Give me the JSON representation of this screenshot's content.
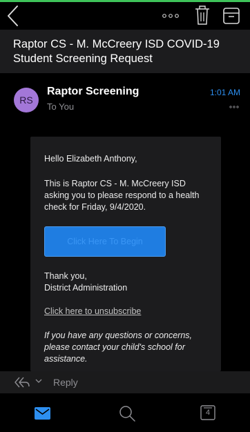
{
  "colors": {
    "accent": "#2d8ff0",
    "avatar_bg": "#a377d8",
    "button_bg": "#1f7de1",
    "status_green": "#3ec35a"
  },
  "nav": {
    "back_icon": "chevron-left-icon",
    "more_icon": "ellipsis-icon",
    "delete_icon": "trash-icon",
    "archive_icon": "archive-icon"
  },
  "message": {
    "subject": "Raptor CS - M. McCreery ISD COVID-19 Student Screening Request",
    "sender": {
      "initials": "RS",
      "name": "Raptor Screening",
      "recipient": "To You",
      "time": "1:01 AM"
    },
    "body": {
      "greeting": "Hello Elizabeth Anthony,",
      "text": "This is Raptor CS - M. McCreery ISD asking you to please respond to a health check for Friday, 9/4/2020.",
      "button_label": "Click Here To Begin",
      "closing_line1": "Thank you,",
      "closing_line2": "District Administration",
      "unsubscribe": "Click here to unsubscribe",
      "note": "If you have any questions or concerns, please contact your child's school for assistance."
    }
  },
  "reply_bar": {
    "label": "Reply",
    "icon": "reply-all-icon"
  },
  "tabbar": {
    "mail_icon": "mail-icon",
    "search_icon": "search-icon",
    "calendar_icon": "calendar-icon",
    "calendar_day": "4"
  }
}
